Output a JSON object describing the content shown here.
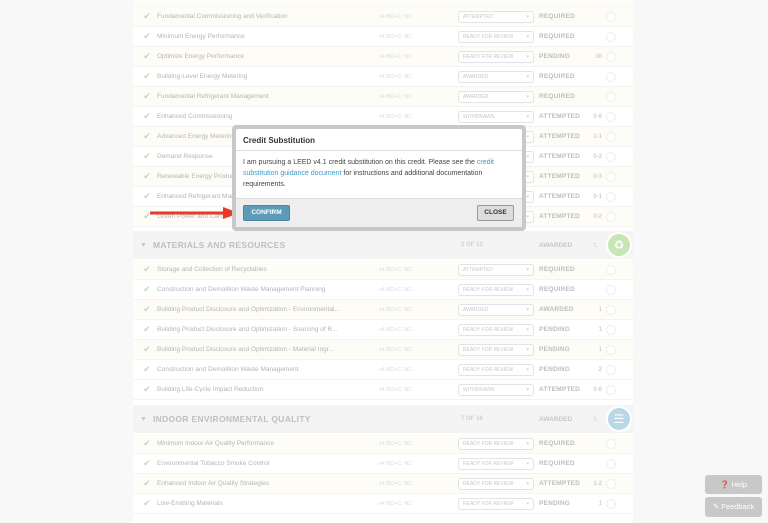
{
  "top_rows": [
    {
      "name": "Fundamental Commissioning and Verification",
      "version": "v4 BD+C: NC",
      "status": "ATTEMPTED",
      "state": "REQUIRED",
      "points": "",
      "check": true
    },
    {
      "name": "Minimum Energy Performance",
      "version": "v4 BD+C: NC",
      "status": "READY FOR REVIEW",
      "state": "REQUIRED",
      "points": "",
      "check": true
    },
    {
      "name": "Optimize Energy Performance",
      "version": "v4 BD+C: NC",
      "status": "READY FOR REVIEW",
      "state": "PENDING",
      "points": "16",
      "check": true
    },
    {
      "name": "Building-Level Energy Metering",
      "version": "v4 BD+C: NC",
      "status": "AWARDED",
      "state": "REQUIRED",
      "points": "",
      "check": true
    },
    {
      "name": "Fundamental Refrigerant Management",
      "version": "v4 BD+C: NC",
      "status": "AWARDED",
      "state": "REQUIRED",
      "points": "",
      "check": true
    },
    {
      "name": "Enhanced Commissioning",
      "version": "v4 BD+C: NC",
      "status": "WITHDRAWN",
      "state": "ATTEMPTED",
      "points": "0-6",
      "check": true
    },
    {
      "name": "Advanced Energy Metering",
      "version": "v4 BD+C: NC",
      "status": "ATTEMPTED",
      "state": "ATTEMPTED",
      "points": "1-1",
      "check": true
    },
    {
      "name": "Demand Response",
      "version": "v4 BD+C: NC",
      "status": "ATTEMPTED",
      "state": "ATTEMPTED",
      "points": "0-2",
      "check": true
    },
    {
      "name": "Renewable Energy Production",
      "version": "v4 BD+C: NC",
      "status": "ATTEMPTED",
      "state": "ATTEMPTED",
      "points": "0-3",
      "check": true
    },
    {
      "name": "Enhanced Refrigerant Management",
      "version": "v4 BD+C: NC",
      "status": "ATTEMPTED",
      "state": "ATTEMPTED",
      "points": "0-1",
      "check": true
    },
    {
      "name": "Green Power and Carbon Offsets",
      "version": "v4 BD+C: NC",
      "status": "ATTEMPTED",
      "state": "ATTEMPTED",
      "points": "0-2",
      "check": true
    }
  ],
  "sections": {
    "materials": {
      "title": "MATERIALS AND RESOURCES",
      "count": "2 OF 13",
      "award": "AWARDED",
      "points": "1",
      "color": "#9ccf7a"
    },
    "indoor": {
      "title": "INDOOR ENVIRONMENTAL QUALITY",
      "count": "7 OF 16",
      "award": "AWARDED",
      "points": "3",
      "color": "#7fb9d6"
    }
  },
  "mr_rows": [
    {
      "name": "Storage and Collection of Recyclables",
      "version": "v4 BD+C: NC",
      "status": "ATTEMPTED",
      "state": "REQUIRED",
      "points": ""
    },
    {
      "name": "Construction and Demolition Waste Management Planning",
      "version": "v4 BD+C: NC",
      "status": "READY FOR REVIEW",
      "state": "REQUIRED",
      "points": ""
    },
    {
      "name": "Building Product Disclosure and Optimization - Environmental...",
      "version": "v4 BD+C: NC",
      "status": "AWARDED",
      "state": "AWARDED",
      "points": "1"
    },
    {
      "name": "Building Product Disclosure and Optimization - Sourcing of R...",
      "version": "v4 BD+C: NC",
      "status": "READY FOR REVIEW",
      "state": "PENDING",
      "points": "1"
    },
    {
      "name": "Building Product Disclosure and Optimization - Material Ingr...",
      "version": "v4 BD+C: NC",
      "status": "READY FOR REVIEW",
      "state": "PENDING",
      "points": "1"
    },
    {
      "name": "Construction and Demolition Waste Management",
      "version": "v4 BD+C: NC",
      "status": "READY FOR REVIEW",
      "state": "PENDING",
      "points": "2"
    },
    {
      "name": "Building Life-Cycle Impact Reduction",
      "version": "v4 BD+C: NC",
      "status": "WITHDRAWN",
      "state": "ATTEMPTED",
      "points": "0-6"
    }
  ],
  "eq_rows": [
    {
      "name": "Minimum Indoor Air Quality Performance",
      "version": "v4 BD+C: NC",
      "status": "READY FOR REVIEW",
      "state": "REQUIRED",
      "points": ""
    },
    {
      "name": "Environmental Tobacco Smoke Control",
      "version": "v4 BD+C: NC",
      "status": "READY FOR REVIEW",
      "state": "REQUIRED",
      "points": ""
    },
    {
      "name": "Enhanced Indoor Air Quality Strategies",
      "version": "v4 BD+C: NC",
      "status": "READY FOR REVIEW",
      "state": "ATTEMPTED",
      "points": "1-2"
    },
    {
      "name": "Low-Emitting Materials",
      "version": "v4 BD+C: NC",
      "status": "READY FOR REVIEW",
      "state": "PENDING",
      "points": "1"
    }
  ],
  "modal": {
    "title": "Credit Substitution",
    "body_before": "I am pursuing a LEED v4.1 credit substitution on this credit. Please see the ",
    "link_text": "credit substitution guidance document",
    "body_after": " for instructions and additional documentation requirements.",
    "confirm_label": "CONFIRM",
    "close_label": "CLOSE"
  },
  "help_label": "Help",
  "feedback_label": "Feedback",
  "colors": {
    "accent_blue": "#5d9cb8",
    "arrow_red": "#e8392a",
    "link": "#3b9bc8"
  }
}
